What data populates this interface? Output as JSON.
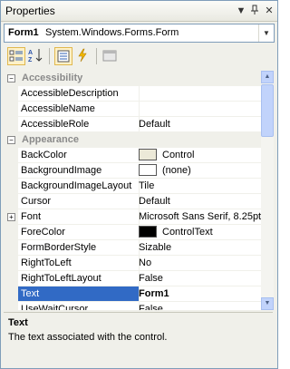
{
  "window": {
    "title": "Properties"
  },
  "object_selector": {
    "name": "Form1",
    "type": "System.Windows.Forms.Form"
  },
  "categories": {
    "accessibility": "Accessibility",
    "appearance": "Appearance"
  },
  "properties": {
    "accessible_description": {
      "name": "AccessibleDescription",
      "value": ""
    },
    "accessible_name": {
      "name": "AccessibleName",
      "value": ""
    },
    "accessible_role": {
      "name": "AccessibleRole",
      "value": "Default"
    },
    "back_color": {
      "name": "BackColor",
      "value": "Control",
      "swatch": "#ece9d8"
    },
    "background_image": {
      "name": "BackgroundImage",
      "value": "(none)",
      "swatch": "#ffffff"
    },
    "background_image_layout": {
      "name": "BackgroundImageLayout",
      "value": "Tile"
    },
    "cursor": {
      "name": "Cursor",
      "value": "Default"
    },
    "font": {
      "name": "Font",
      "value": "Microsoft Sans Serif, 8.25pt"
    },
    "fore_color": {
      "name": "ForeColor",
      "value": "ControlText",
      "swatch": "#000000"
    },
    "form_border_style": {
      "name": "FormBorderStyle",
      "value": "Sizable"
    },
    "right_to_left": {
      "name": "RightToLeft",
      "value": "No"
    },
    "right_to_left_layout": {
      "name": "RightToLeftLayout",
      "value": "False"
    },
    "text": {
      "name": "Text",
      "value": "Form1"
    },
    "use_wait_cursor": {
      "name": "UseWaitCursor",
      "value": "False"
    }
  },
  "description": {
    "title": "Text",
    "body": "The text associated with the control."
  },
  "colors": {
    "selection": "#316ac5",
    "accent": "#e0b84d"
  }
}
